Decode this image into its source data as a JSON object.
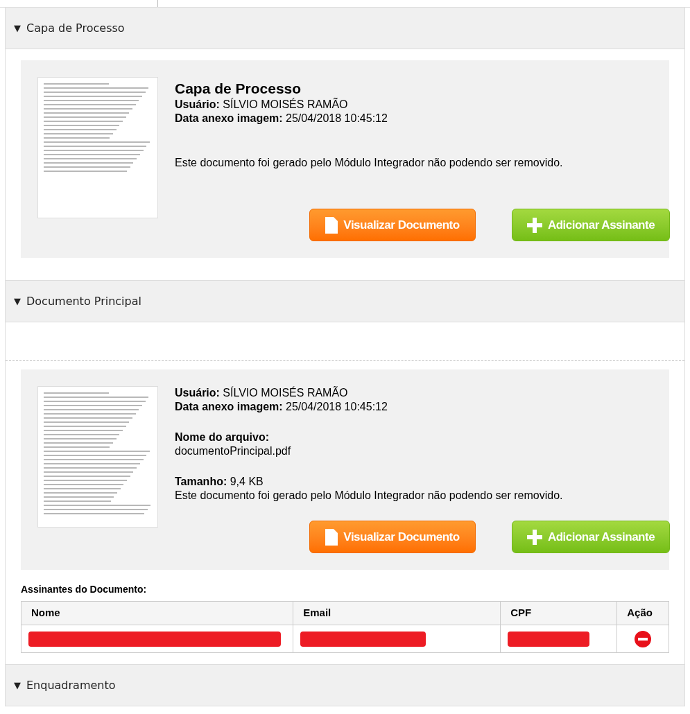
{
  "sections": [
    {
      "toggle": "▼",
      "title": "Capa de Processo",
      "expanded": true,
      "kind": "cover",
      "documents": [
        {
          "heading": "Capa de Processo",
          "user_label": "Usuário:",
          "user": "SÍLVIO MOISÉS RAMÃO",
          "date_label": "Data anexo imagem:",
          "date": "25/04/2018 10:45:12",
          "note": "Este documento foi gerado pelo Módulo Integrador não podendo ser removido.",
          "buttons": [
            {
              "kind": "view",
              "label": "Visualizar Documento"
            },
            {
              "kind": "add",
              "label": "Adicionar Assinante"
            }
          ]
        }
      ]
    },
    {
      "toggle": "▼",
      "title": "Documento Principal",
      "expanded": true,
      "kind": "main",
      "documents": [
        {
          "user_label": "Usuário:",
          "user": "SÍLVIO MOISÉS RAMÃO",
          "date_label": "Data anexo imagem:",
          "date": "25/04/2018 10:45:12",
          "file_label": "Nome do arquivo:",
          "file": "documentoPrincipal.pdf",
          "size_label": "Tamanho:",
          "size": "9,4 KB",
          "note": "Este documento foi gerado pelo Módulo Integrador não podendo ser removido.",
          "buttons": [
            {
              "kind": "view",
              "label": "Visualizar Documento"
            },
            {
              "kind": "add",
              "label": "Adicionar Assinante"
            }
          ]
        }
      ],
      "signers": {
        "title": "Assinantes do Documento:",
        "columns": [
          "Nome",
          "Email",
          "CPF",
          "Ação"
        ],
        "rows": [
          {
            "cells": [
              {
                "redacted": true
              },
              {
                "redacted": true
              },
              {
                "redacted": true
              }
            ],
            "removable": true
          }
        ]
      }
    },
    {
      "toggle": "▼",
      "title": "Enquadramento",
      "expanded": true,
      "kind": "empty"
    }
  ]
}
